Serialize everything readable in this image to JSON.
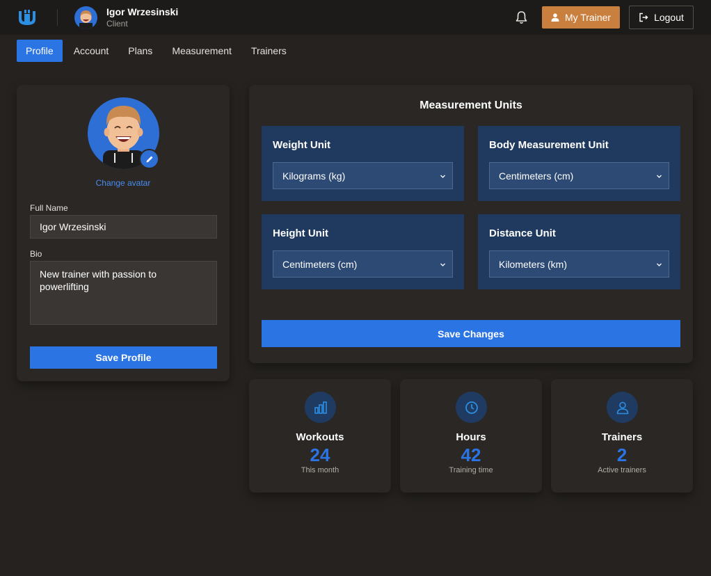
{
  "header": {
    "user_name": "Igor Wrzesinski",
    "user_role": "Client",
    "my_trainer_label": "My Trainer",
    "logout_label": "Logout"
  },
  "tabs": [
    {
      "label": "Profile",
      "active": true
    },
    {
      "label": "Account"
    },
    {
      "label": "Plans"
    },
    {
      "label": "Measurement"
    },
    {
      "label": "Trainers"
    }
  ],
  "profile": {
    "change_avatar_label": "Change avatar",
    "full_name_label": "Full Name",
    "full_name_value": "Igor Wrzesinski",
    "bio_label": "Bio",
    "bio_value": "New trainer with passion to powerlifting",
    "save_label": "Save Profile"
  },
  "units": {
    "title": "Measurement Units",
    "weight": {
      "label": "Weight Unit",
      "value": "Kilograms (kg)"
    },
    "body": {
      "label": "Body Measurement Unit",
      "value": "Centimeters (cm)"
    },
    "height": {
      "label": "Height Unit",
      "value": "Centimeters (cm)"
    },
    "distance": {
      "label": "Distance Unit",
      "value": "Kilometers (km)"
    },
    "save_label": "Save Changes"
  },
  "stats": [
    {
      "label": "Workouts",
      "value": "24",
      "sub": "This month",
      "icon": "bar-chart-icon"
    },
    {
      "label": "Hours",
      "value": "42",
      "sub": "Training time",
      "icon": "clock-icon"
    },
    {
      "label": "Trainers",
      "value": "2",
      "sub": "Active trainers",
      "icon": "user-icon"
    }
  ],
  "colors": {
    "accent": "#2b74e4",
    "trainer_button": "#c97f3d",
    "background": "#25221f",
    "unit_box": "#1f3a5e"
  }
}
